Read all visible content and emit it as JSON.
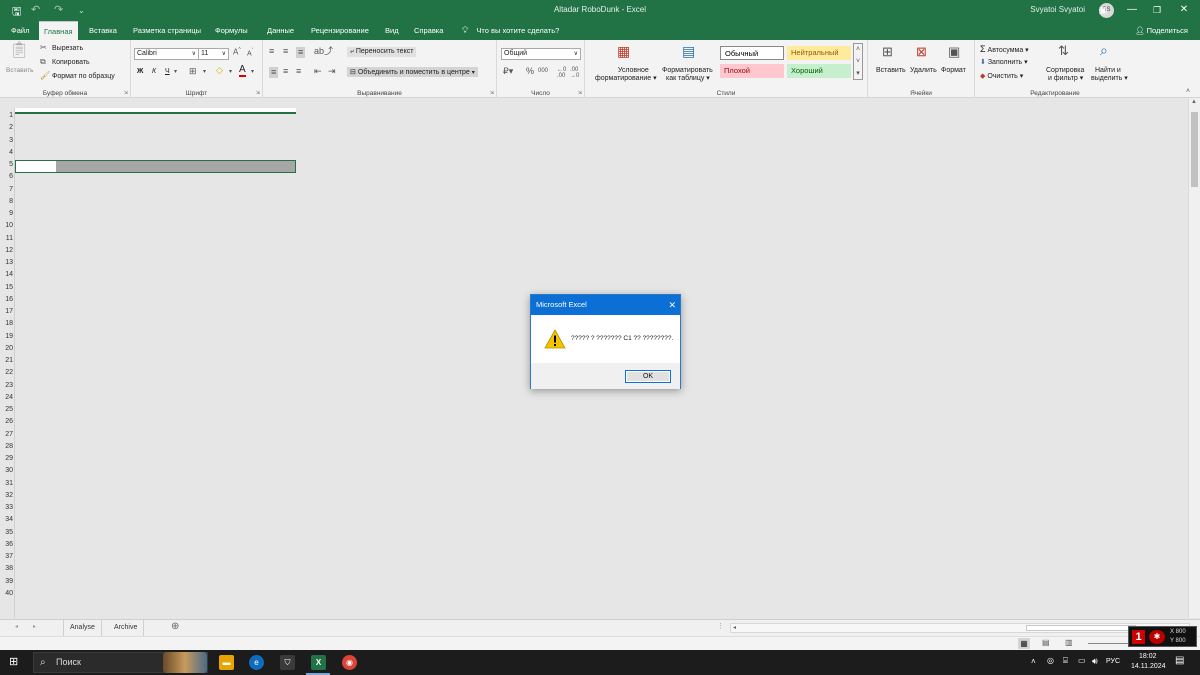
{
  "titlebar": {
    "title": "Altadar RoboDunk - Excel",
    "user_name": "Svyatoi Svyatoi",
    "user_initials": "SS",
    "accent": "#217346"
  },
  "tabs": [
    "Файл",
    "Главная",
    "Вставка",
    "Разметка страницы",
    "Формулы",
    "Данные",
    "Рецензирование",
    "Вид",
    "Справка"
  ],
  "tell_me": "Что вы хотите сделать?",
  "share": "Поделиться",
  "ribbon": {
    "clipboard": {
      "paste": "Вставить",
      "cut": "Вырезать",
      "copy": "Копировать",
      "format_painter": "Формат по образцу",
      "label": "Буфер обмена"
    },
    "font": {
      "name": "Calibri",
      "size": "11",
      "bold": "Ж",
      "italic": "К",
      "underline": "Ч",
      "label": "Шрифт"
    },
    "alignment": {
      "wrap": "Переносить текст",
      "merge": "Объединить и поместить в центре",
      "label": "Выравнивание"
    },
    "number": {
      "format": "Общий",
      "label": "Число"
    },
    "styles": {
      "cond_line1": "Условное",
      "cond_line2": "форматирование",
      "table_line1": "Форматировать",
      "table_line2": "как таблицу",
      "normal": "Обычный",
      "neutral": "Нейтральный",
      "bad": "Плохой",
      "good": "Хороший",
      "label": "Стили"
    },
    "cells": {
      "insert": "Вставить",
      "delete": "Удалить",
      "format": "Формат",
      "label": "Ячейки"
    },
    "editing": {
      "autosum": "Автосумма",
      "fill": "Заполнить",
      "clear": "Очистить",
      "sort_line1": "Сортировка",
      "sort_line2": "и фильтр",
      "find_line1": "Найти и",
      "find_line2": "выделить",
      "label": "Редактирование"
    }
  },
  "rows": [
    "1",
    "2",
    "3",
    "4",
    "5",
    "6",
    "7",
    "8",
    "9",
    "10",
    "11",
    "12",
    "13",
    "14",
    "15",
    "16",
    "17",
    "18",
    "19",
    "20",
    "21",
    "22",
    "23",
    "24",
    "25",
    "26",
    "27",
    "28",
    "29",
    "30",
    "31",
    "32",
    "33",
    "34",
    "35",
    "36",
    "37",
    "38",
    "39",
    "40"
  ],
  "sheets": [
    "Analyse",
    "Archive"
  ],
  "dialog": {
    "title": "Microsoft Excel",
    "message": "????? ? ??????? C1 ?? ????????.",
    "ok": "OK"
  },
  "taskbar": {
    "search": "Поиск",
    "lang": "РУС",
    "time": "18:02",
    "date": "14.11.2024"
  },
  "overlay": {
    "x": "X 800",
    "y": "Y 800"
  }
}
